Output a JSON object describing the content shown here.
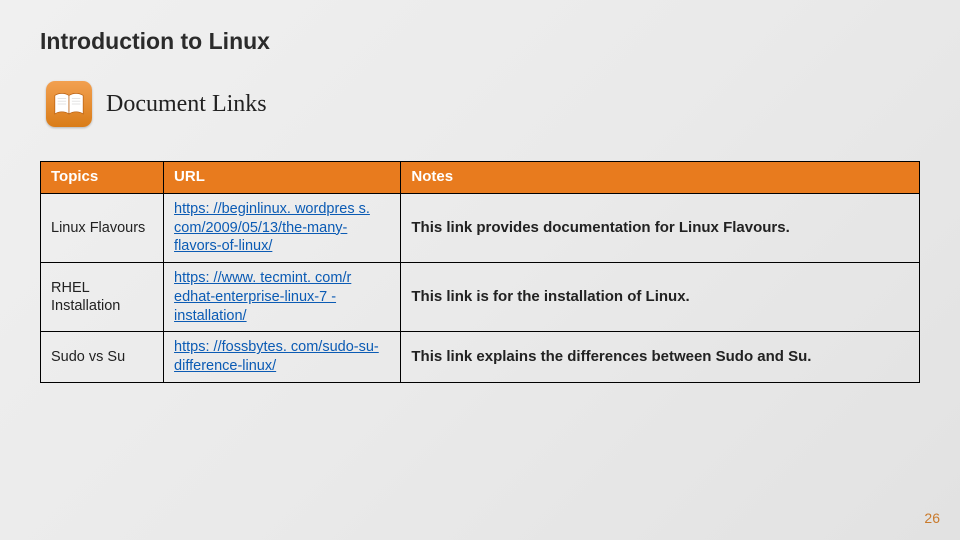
{
  "title": "Introduction to Linux",
  "subtitle": "Document Links",
  "icon_name": "book-icon",
  "page_number": "26",
  "table": {
    "headers": {
      "topics": "Topics",
      "url": "URL",
      "notes": "Notes"
    },
    "rows": [
      {
        "topic": "Linux Flavours",
        "url": "https: //beginlinux. wordpres s. com/2009/05/13/the-many-flavors-of-linux/",
        "notes": "This link provides documentation for Linux Flavours."
      },
      {
        "topic": "RHEL Installation",
        "url": "https: //www. tecmint. com/r edhat-enterprise-linux-7 -installation/",
        "notes": "This link is for the installation of Linux."
      },
      {
        "topic": "Sudo vs Su",
        "url": "https: //fossbytes. com/sudo-su-difference-linux/",
        "notes": "This link explains the differences between Sudo and Su."
      }
    ]
  }
}
